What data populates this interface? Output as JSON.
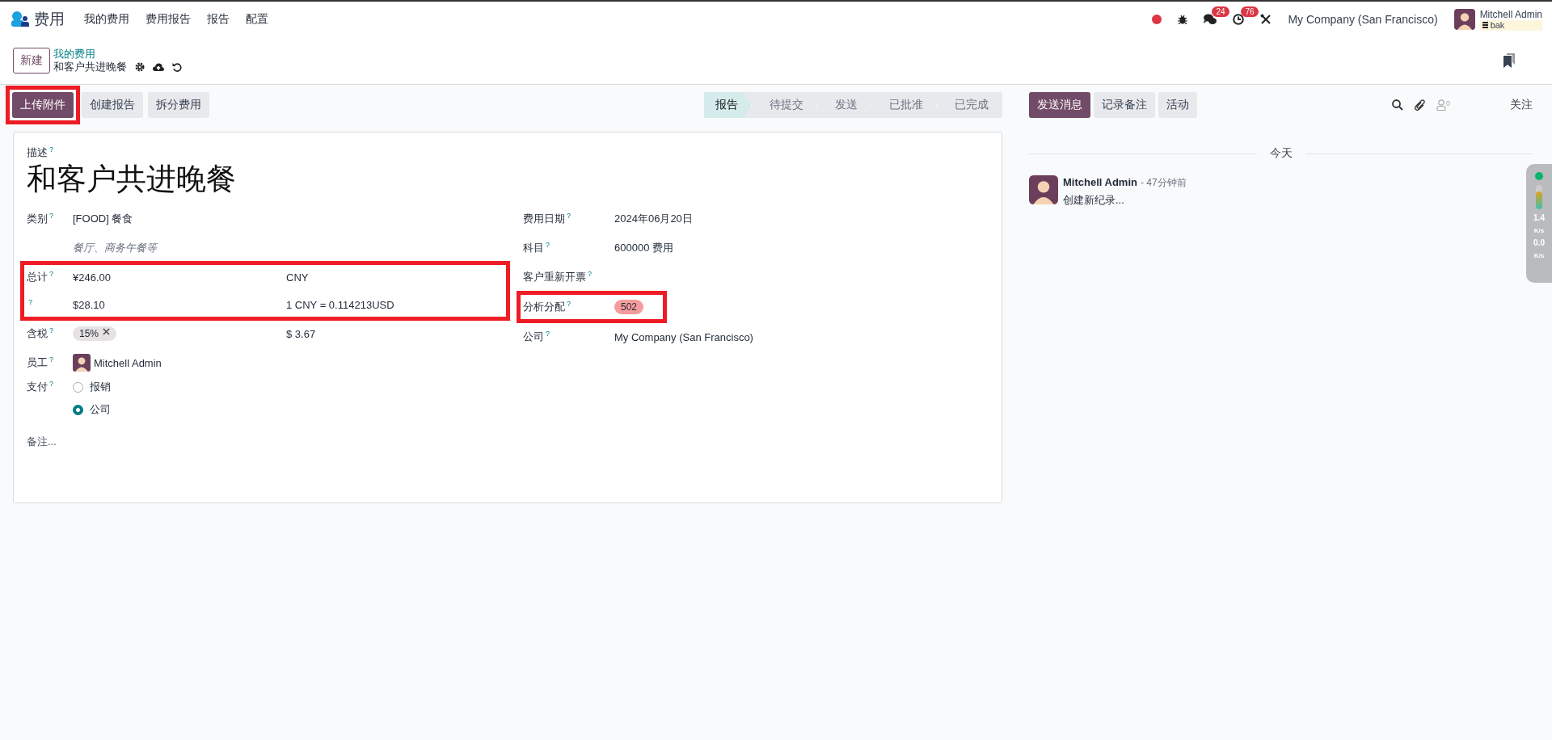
{
  "navbar": {
    "app_name": "费用",
    "menus": [
      "我的费用",
      "费用报告",
      "报告",
      "配置"
    ],
    "chat_count": "24",
    "activity_count": "76",
    "company": "My Company (San Francisco)",
    "user": "Mitchell Admin",
    "database": "bak"
  },
  "breadcrumb": {
    "new_button": "新建",
    "parent": "我的费用",
    "current": "和客户共进晚餐"
  },
  "actions": [
    {
      "label": "上传附件",
      "kind": "primary",
      "highlighted": true
    },
    {
      "label": "创建报告",
      "kind": "secondary"
    },
    {
      "label": "拆分费用",
      "kind": "secondary"
    }
  ],
  "statusbar": [
    {
      "label": "报告",
      "selected": true
    },
    {
      "label": "待提交",
      "selected": false
    },
    {
      "label": "发送",
      "selected": false
    },
    {
      "label": "已批准",
      "selected": false
    },
    {
      "label": "已完成",
      "selected": false
    }
  ],
  "form": {
    "description_label": "描述",
    "help": "?",
    "title": "和客户共进晚餐",
    "left": [
      {
        "kind": "text",
        "label": "类别",
        "value": "[FOOD] 餐食"
      },
      {
        "kind": "note",
        "value": "餐厅、商务午餐等"
      },
      {
        "kind": "group",
        "highlighted": true,
        "rows": [
          {
            "label": "总计",
            "value": "¥246.00",
            "extra": "CNY"
          },
          {
            "value": "$28.10",
            "extra": "1 CNY = 0.114213USD"
          }
        ]
      },
      {
        "kind": "tags",
        "label": "含税",
        "tags": [
          "15%"
        ],
        "extra": "$ 3.67"
      },
      {
        "kind": "avatar",
        "label": "员工",
        "value": "Mitchell Admin"
      },
      {
        "kind": "radio",
        "label": "支付",
        "options": [
          {
            "label": "报销",
            "selected": false
          },
          {
            "label": "公司",
            "selected": true
          }
        ]
      }
    ],
    "right": [
      {
        "kind": "text",
        "label": "费用日期",
        "value": "2024年06月20日"
      },
      {
        "kind": "text",
        "label": "科目",
        "value": "600000 费用"
      },
      {
        "kind": "empty",
        "label": "客户重新开票"
      },
      {
        "kind": "badge",
        "label": "分析分配",
        "value": "502",
        "highlighted": true
      },
      {
        "kind": "text",
        "label": "公司",
        "value": "My Company (San Francisco)"
      }
    ],
    "notes_placeholder": "备注..."
  },
  "chatter": {
    "buttons": [
      {
        "label": "发送消息",
        "kind": "primary"
      },
      {
        "label": "记录备注",
        "kind": "secondary"
      },
      {
        "label": "活动",
        "kind": "secondary"
      }
    ],
    "followers_count": "0",
    "follow": "关注",
    "date_divider": "今天",
    "messages": [
      {
        "author": "Mitchell Admin",
        "time": "- 47分钟前",
        "body": "创建新纪录..."
      }
    ]
  },
  "speed_widget": {
    "upload": "1.4",
    "upload_unit": "K/s",
    "download": "0.0",
    "download_unit": "K/s"
  }
}
